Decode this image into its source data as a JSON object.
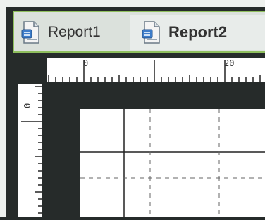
{
  "tabs": [
    {
      "label": "Report1",
      "icon": "report-icon",
      "active": false
    },
    {
      "label": "Report2",
      "icon": "report-icon",
      "active": true
    }
  ],
  "ruler": {
    "horizontal_labels": [
      "0",
      "20"
    ],
    "vertical_labels": [
      "0"
    ]
  },
  "colors": {
    "tab_border_accent": "#8fbf5e",
    "workspace_bg": "#262b2a",
    "page_bg": "#ffffff"
  }
}
